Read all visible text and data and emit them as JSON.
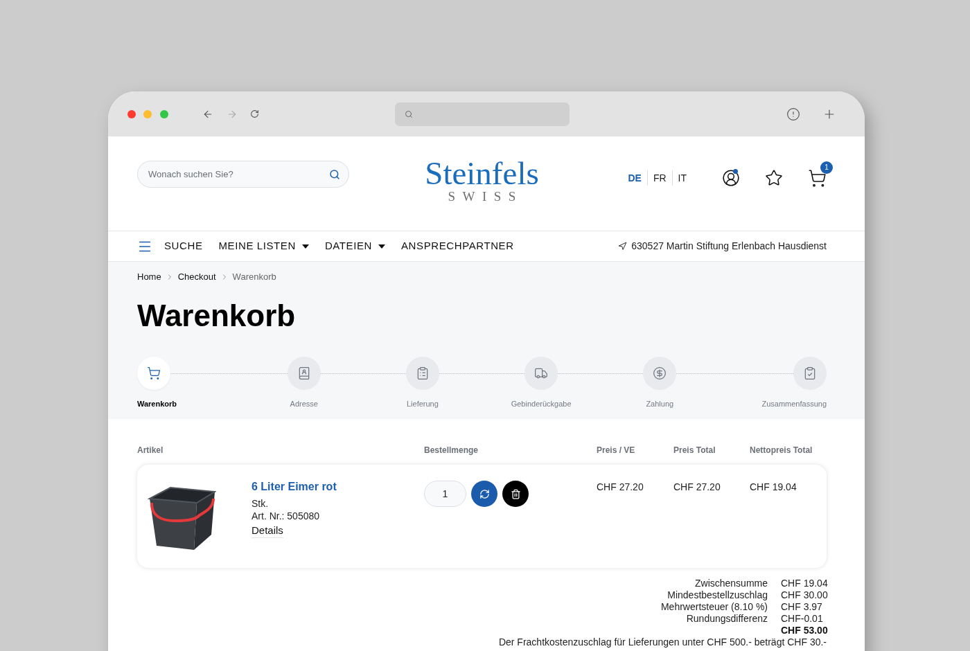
{
  "browser": {
    "forward_disabled": true
  },
  "header": {
    "search": {
      "placeholder": "Wonach suchen Sie?"
    },
    "logo": {
      "name": "Steinfels",
      "tagline": "SWISS"
    },
    "languages": [
      {
        "label": "DE",
        "selected": true
      },
      {
        "label": "FR",
        "selected": false
      },
      {
        "label": "IT",
        "selected": false
      }
    ],
    "account": {
      "notification": true
    },
    "cart": {
      "count": "1"
    }
  },
  "nav": {
    "items": [
      {
        "label": "SUCHE",
        "dropdown": false
      },
      {
        "label": "MEINE LISTEN",
        "dropdown": true
      },
      {
        "label": "DATEIEN",
        "dropdown": true
      },
      {
        "label": "ANSPRECHPARTNER",
        "dropdown": false
      }
    ],
    "location": "630527 Martin Stiftung Erlenbach Hausdienst"
  },
  "breadcrumb": [
    {
      "label": "Home",
      "current": false
    },
    {
      "label": "Checkout",
      "current": false
    },
    {
      "label": "Warenkorb",
      "current": true
    }
  ],
  "title": "Warenkorb",
  "steps": [
    {
      "kind": "cart",
      "label": "Warenkorb",
      "selected": true
    },
    {
      "kind": "address",
      "label": "Adresse",
      "selected": false
    },
    {
      "kind": "delivery",
      "label": "Lieferung",
      "selected": false
    },
    {
      "kind": "container_return",
      "label": "Gebinderückgabe",
      "selected": false
    },
    {
      "kind": "payment",
      "label": "Zahlung",
      "selected": false
    },
    {
      "kind": "summary",
      "label": "Zusammenfassung",
      "selected": false
    }
  ],
  "table": {
    "columns": [
      "Artikel",
      "Bestellmenge",
      "Preis / VE",
      "Preis Total",
      "Nettopreis Total"
    ],
    "rows": [
      {
        "name": "6 Liter Eimer rot",
        "unit": "Stk.",
        "article_number": "Art. Nr.: 505080",
        "details_link": "Details",
        "quantity": "1",
        "price_per_unit": "CHF 27.20",
        "price_total": "CHF 27.20",
        "net_price_total": "CHF 19.04"
      }
    ]
  },
  "totals": [
    {
      "label": "Zwischensumme",
      "value": "CHF 19.04",
      "bold": false
    },
    {
      "label": "Mindestbestellzuschlag",
      "value": "CHF 30.00",
      "bold": false
    },
    {
      "label": "Mehrwertsteuer (8.10 %)",
      "value": "CHF 3.97",
      "bold": false
    },
    {
      "label": "Rundungsdifferenz",
      "value": "CHF-0.01",
      "bold": false
    },
    {
      "value": "CHF 53.00",
      "bold": true
    }
  ],
  "note": "Der Frachtkostenzuschlag für Lieferungen unter CHF 500.- beträgt CHF 30.-"
}
